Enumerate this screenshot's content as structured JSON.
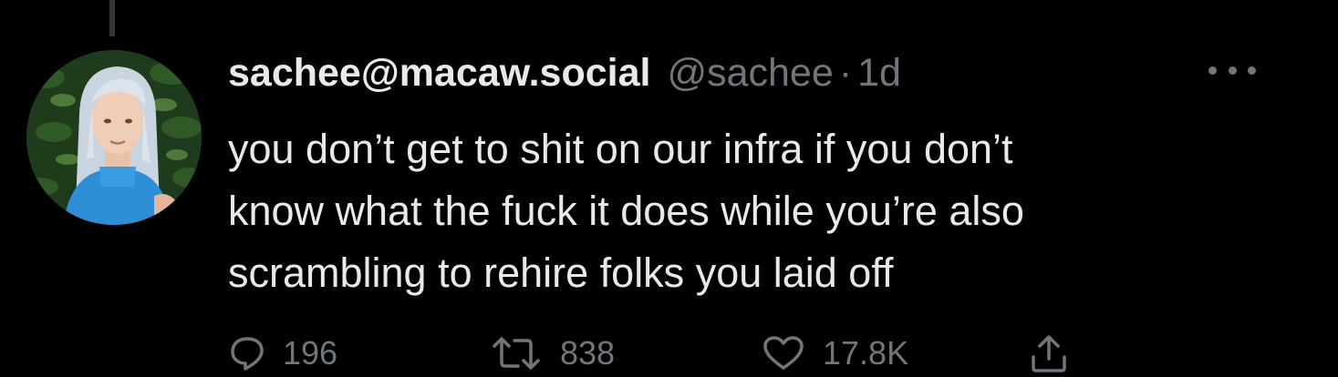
{
  "tweet": {
    "display_name": "sachee@macaw.social",
    "handle": "@sachee",
    "separator": "·",
    "time": "1d",
    "lines": [
      "you don’t get to shit on our infra if you don’t",
      "know what the fuck it does while you’re also",
      "scrambling to rehire folks you laid off"
    ]
  },
  "actions": {
    "reply_count": "196",
    "retweet_count": "838",
    "like_count": "17.8K"
  },
  "icons": {
    "reply": "reply-icon",
    "retweet": "retweet-icon",
    "like": "heart-icon",
    "share": "share-icon",
    "more": "more-icon"
  },
  "colors": {
    "background": "#000000",
    "text_primary": "#e7e9ea",
    "text_secondary": "#71767b"
  }
}
